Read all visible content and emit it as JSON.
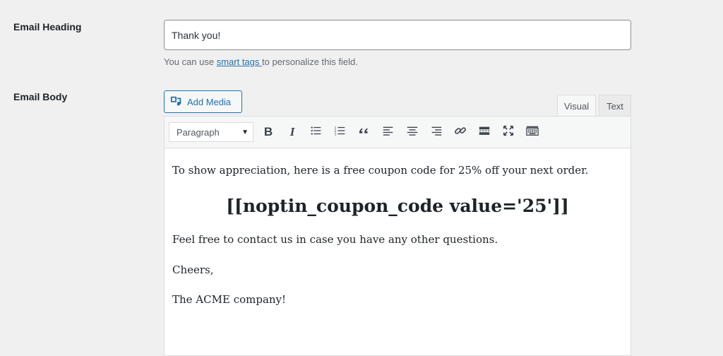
{
  "labels": {
    "email_heading": "Email Heading",
    "email_body": "Email Body"
  },
  "heading_field": {
    "value": "Thank you!"
  },
  "help": {
    "prefix": "You can use ",
    "link": "smart tags ",
    "suffix": "to personalize this field."
  },
  "media": {
    "add_media_label": "Add Media"
  },
  "tabs": {
    "visual": "Visual",
    "text": "Text"
  },
  "toolbar": {
    "format_selected": "Paragraph",
    "bold": "B",
    "italic": "I"
  },
  "body": {
    "line1": "To show appreciation, here is a free coupon code for 25% off your next order.",
    "coupon": "[[noptin_coupon_code value='25']]",
    "line2": "Feel free to contact us in case you have any other questions.",
    "line3": "Cheers,",
    "line4": "The ACME company!"
  },
  "colors": {
    "link": "#2271b1",
    "background": "#f0f0f1",
    "text": "#1d2327"
  }
}
